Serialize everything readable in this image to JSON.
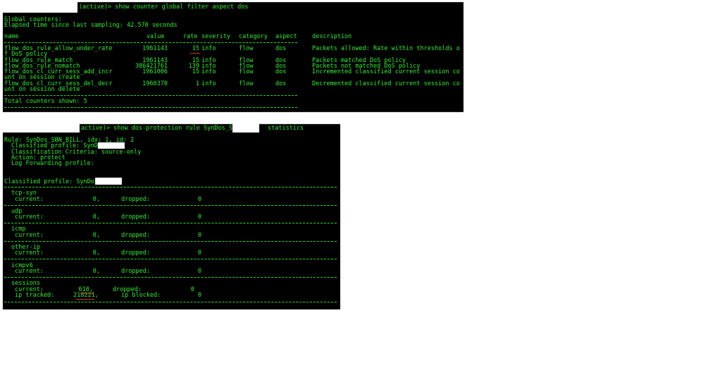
{
  "terminal_1": {
    "prompt": "(active)> show counter global filter aspect dos",
    "heading": "Global counters:",
    "elapsed": "Elapsed time since last sampling: 42.570 seconds",
    "columns": {
      "name": "name",
      "value": "value",
      "rate": "rate",
      "severity": "severity",
      "category": "category",
      "aspect": "aspect",
      "description": "description"
    },
    "rows": [
      {
        "name": "flow_dos_rule_allow_under_rate",
        "value": "1961143",
        "rate": "15",
        "severity": "info",
        "category": "flow",
        "aspect": "dos",
        "description": "Packets allowed: Rate within thresholds o",
        "wrap": "f DoS policy"
      },
      {
        "name": "flow_dos_rule_match",
        "value": "1961143",
        "rate": "15",
        "severity": "info",
        "category": "flow",
        "aspect": "dos",
        "description": "Packets matched DoS policy",
        "wrap": ""
      },
      {
        "name": "flow_dos_rule_nomatch",
        "value": "386421761",
        "rate": "139",
        "severity": "info",
        "category": "flow",
        "aspect": "dos",
        "description": "Packets not matched DoS policy",
        "wrap": ""
      },
      {
        "name": "flow_dos_cl_curr_sess_add_incr",
        "value": "1961006",
        "rate": "15",
        "severity": "info",
        "category": "flow",
        "aspect": "dos",
        "description": "Incremented classified current session co",
        "wrap": "unt on session create"
      },
      {
        "name": "flow_dos_cl_curr_sess_del_decr",
        "value": "1960370",
        "rate": "1",
        "severity": "info",
        "category": "flow",
        "aspect": "dos",
        "description": "Decremented classified current session co",
        "wrap": "unt on session delete"
      }
    ],
    "total": "Total counters shown: 5"
  },
  "terminal_2": {
    "prompt_before": "active)> show dos-protection rule SynDos_S",
    "prompt_after": "statistics",
    "rule_line": "Rule: SynDos_SBN_BILL, idx: 1, id: 2",
    "classified_profile": "Classified profile: SynD",
    "classification_criteria": "Classification Criteria: source-only",
    "action": "Action: protect",
    "log_forwarding": "Log Forwarding profile:",
    "classified_profile_2": "Classified profile: SynDo",
    "labels": {
      "current": "current:",
      "dropped": "dropped:",
      "ip_tracked": "ip tracked:",
      "ip_blocked": "ip blocked:"
    },
    "sections": [
      {
        "name": "tcp-syn",
        "current": "0,",
        "dropped": "0"
      },
      {
        "name": "udp",
        "current": "0,",
        "dropped": "0"
      },
      {
        "name": "icmp",
        "current": "0,",
        "dropped": "0"
      },
      {
        "name": "other-ip",
        "current": "0,",
        "dropped": "0"
      },
      {
        "name": "icmpv6",
        "current": "0,",
        "dropped": "0"
      }
    ],
    "sessions": {
      "name": "sessions",
      "current": "610,",
      "dropped": "0",
      "ip_tracked": "218221,",
      "ip_blocked": "0"
    }
  },
  "colors": {
    "terminal_bg": "#000000",
    "terminal_text": "#3ef53e",
    "annotation_red": "#e53b2e",
    "redaction": "#ffffff"
  }
}
